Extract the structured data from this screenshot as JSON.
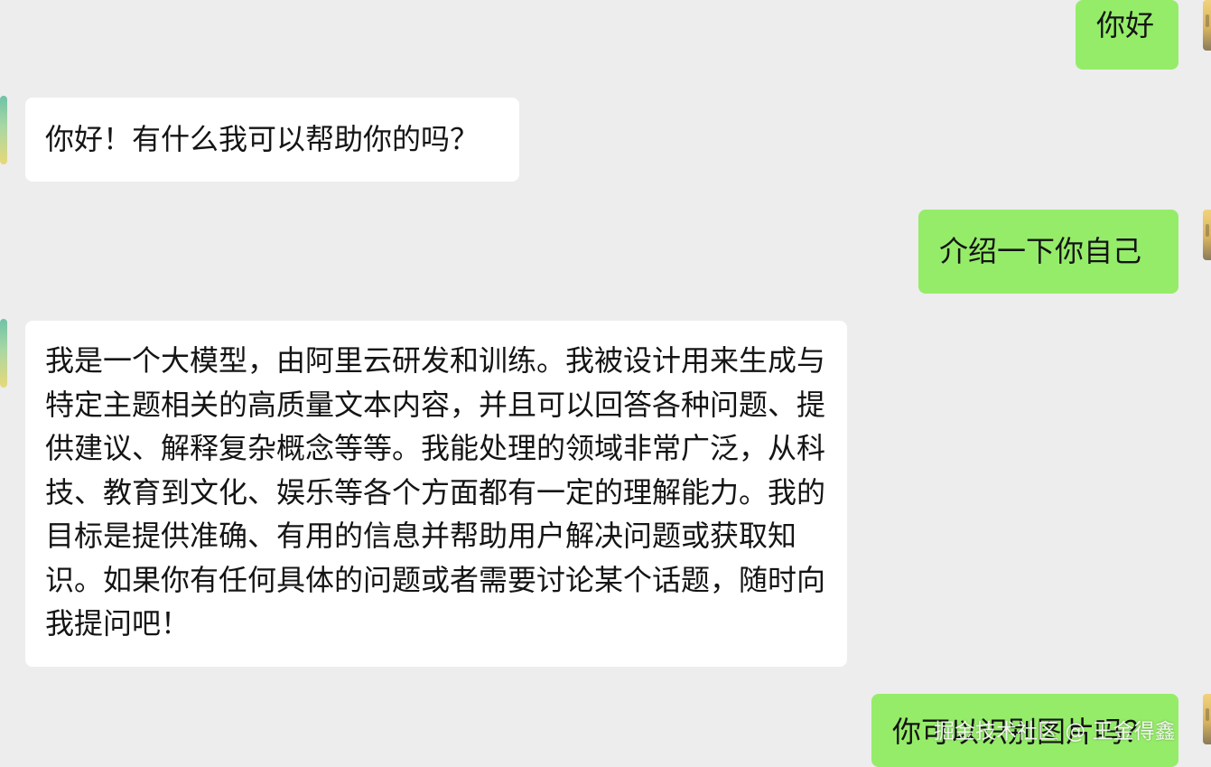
{
  "messages": [
    {
      "sender": "user",
      "text": "你好"
    },
    {
      "sender": "bot",
      "text": "你好！有什么我可以帮助你的吗？"
    },
    {
      "sender": "user",
      "text": "介绍一下你自己"
    },
    {
      "sender": "bot",
      "text": "我是一个大模型，由阿里云研发和训练。我被设计用来生成与特定主题相关的高质量文本内容，并且可以回答各种问题、提供建议、解释复杂概念等等。我能处理的领域非常广泛，从科技、教育到文化、娱乐等各个方面都有一定的理解能力。我的目标是提供准确、有用的信息并帮助用户解决问题或获取知识。如果你有任何具体的问题或者需要讨论某个话题，随时向我提问吧！"
    },
    {
      "sender": "user",
      "text": "你可以识别图片吗？"
    }
  ],
  "watermark": "掘金技术社区 @ 王金得鑫",
  "colors": {
    "background": "#ededed",
    "incoming_bubble": "#ffffff",
    "outgoing_bubble": "#95ec69",
    "text": "#141414"
  },
  "icons": {
    "bot_avatar": "bot-avatar-icon",
    "user_avatar": "user-avatar-icon"
  }
}
